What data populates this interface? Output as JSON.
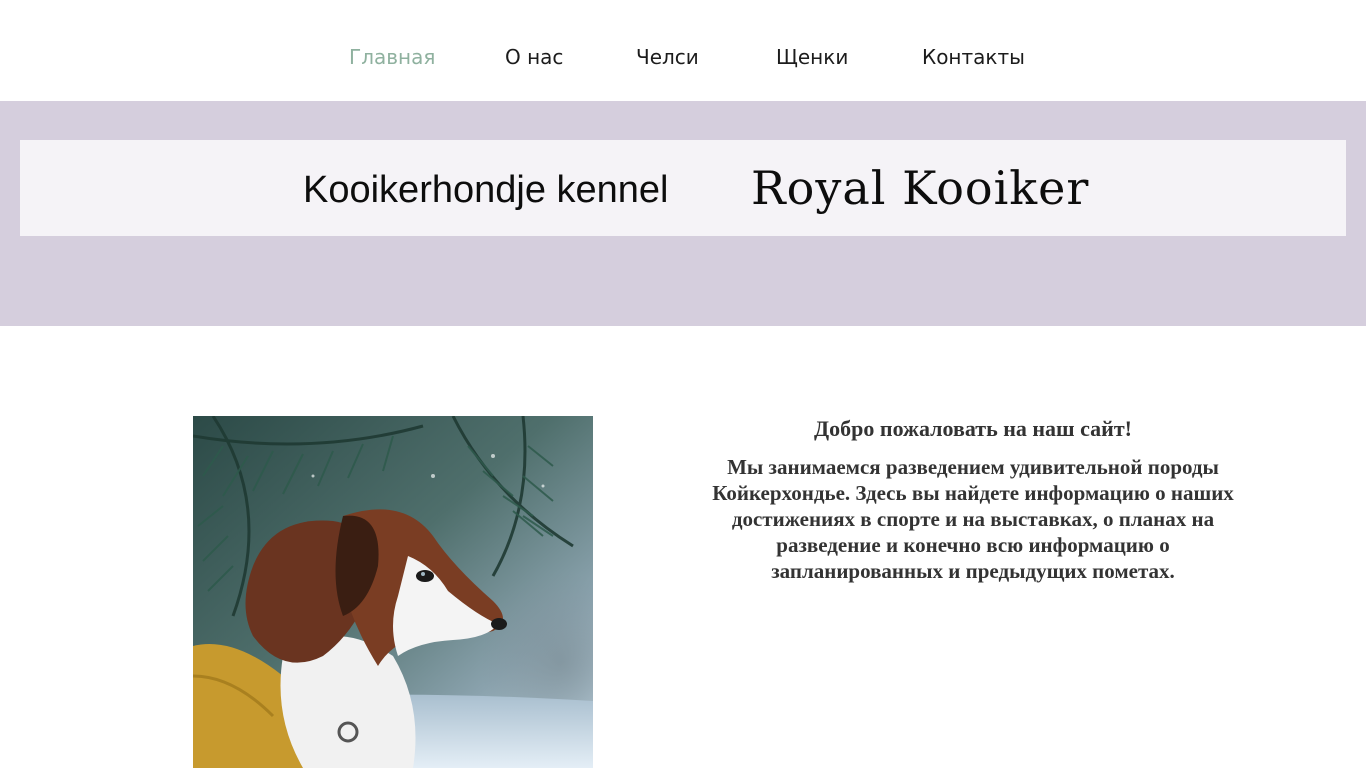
{
  "nav": {
    "items": [
      {
        "label": "Главная",
        "active": true
      },
      {
        "label": "О нас"
      },
      {
        "label": "Челси"
      },
      {
        "label": "Щенки"
      },
      {
        "label": "Контакты"
      }
    ],
    "active_color": "#8fb19f"
  },
  "hero": {
    "kennel_text": "Kooikerhondje kennel",
    "brand_name": "Royal Kooiker",
    "background_color": "#d5cedd"
  },
  "intro": {
    "welcome": "Добро пожаловать на наш сайт!",
    "description": "Мы занимаемся разведением удивительной породы Койкерхондье. Здесь вы найдете информацию о наших достижениях в спорте и на выставках, о планах на разведение и конечно всю информацию о запланированных и предыдущих пометах."
  },
  "photo": {
    "icon": "dog-photo"
  }
}
